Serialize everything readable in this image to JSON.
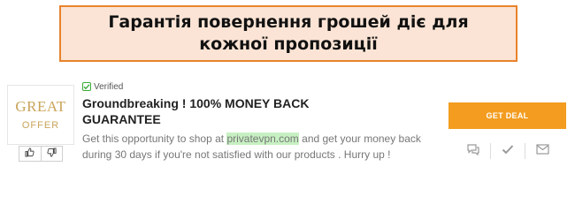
{
  "banner": {
    "title": "Гарантія повернення грошей діє для кожної пропозиції"
  },
  "offer": {
    "logo_line1": "GREAT",
    "logo_line2": "OFFER",
    "verified_label": "Verified",
    "title": "Groundbreaking ! 100% MONEY BACK GUARANTEE",
    "desc_before": "Get this opportunity to shop at ",
    "desc_highlight": "privatevpn.com",
    "desc_after": " and get your money back during 30 days if you're not satisfied with our products . Hurry up !",
    "cta_label": "GET DEAL"
  },
  "icons": {
    "thumbs_up": "thumbs-up-icon",
    "thumbs_down": "thumbs-down-icon",
    "comment": "comment-icon",
    "check": "check-icon",
    "email": "email-icon"
  },
  "colors": {
    "banner_bg": "#fbe4d5",
    "banner_border": "#e8832c",
    "cta": "#f39c1f",
    "highlight": "#c7f0c2",
    "verified": "#3aaa35"
  }
}
